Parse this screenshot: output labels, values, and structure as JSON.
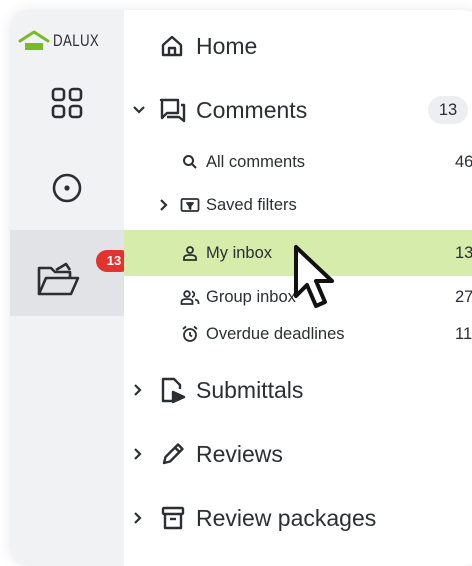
{
  "brand": {
    "name": "DALUX",
    "accent": "#7ab929"
  },
  "rail": {
    "items": [
      {
        "icon": "dashboard-grid-icon"
      },
      {
        "icon": "location-pin-icon"
      },
      {
        "icon": "folder-icon",
        "badge": "13",
        "active": true
      }
    ]
  },
  "nav": {
    "home": {
      "label": "Home",
      "icon": "home-icon"
    },
    "comments": {
      "label": "Comments",
      "icon": "comments-icon",
      "count": "13",
      "expanded": true,
      "children": [
        {
          "label": "All comments",
          "icon": "search-icon",
          "count": "46"
        },
        {
          "label": "Saved filters",
          "icon": "filter-folder-icon",
          "count": ""
        },
        {
          "label": "My inbox",
          "icon": "person-icon",
          "count": "13",
          "selected": true
        },
        {
          "label": "Group inbox",
          "icon": "group-icon",
          "count": "27"
        },
        {
          "label": "Overdue deadlines",
          "icon": "alarm-clock-icon",
          "count": "11"
        }
      ]
    },
    "submittals": {
      "label": "Submittals",
      "icon": "submittals-icon"
    },
    "reviews": {
      "label": "Reviews",
      "icon": "pencil-icon"
    },
    "review_packages": {
      "label": "Review packages",
      "icon": "archive-box-icon"
    }
  },
  "colors": {
    "selected_bg": "#d6ecaa",
    "badge_red": "#e2342f",
    "rail_bg": "#f1f2f4"
  }
}
